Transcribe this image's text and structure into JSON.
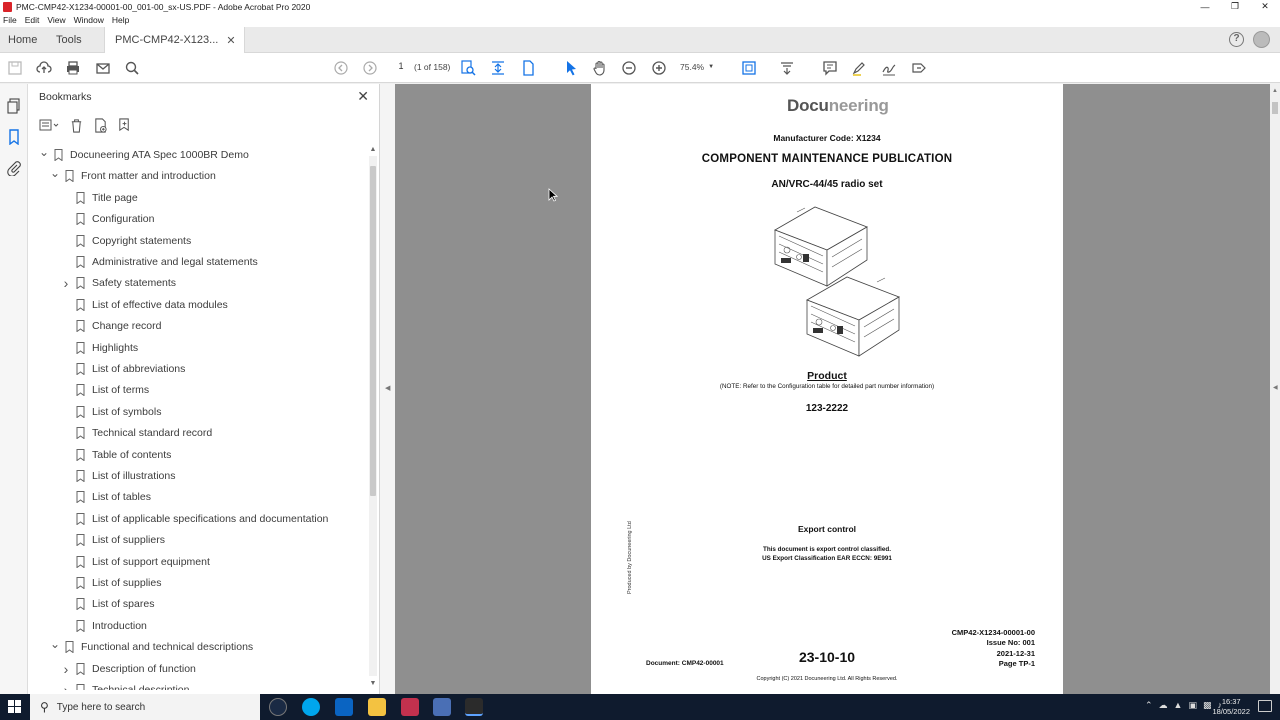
{
  "window": {
    "title": "PMC-CMP42-X1234-00001-00_001-00_sx-US.PDF - Adobe Acrobat Pro 2020"
  },
  "menu": [
    "File",
    "Edit",
    "View",
    "Window",
    "Help"
  ],
  "tabs": {
    "home": "Home",
    "tools": "Tools",
    "document": "PMC-CMP42-X123..."
  },
  "toolbar": {
    "page_number": "1",
    "page_count": "(1 of 158)",
    "zoom": "75.4%"
  },
  "bookmarks": {
    "header": "Bookmarks",
    "items": [
      {
        "label": "Docuneering ATA Spec 1000BR Demo",
        "level": 0,
        "toggle": "expanded"
      },
      {
        "label": "Front matter and introduction",
        "level": 1,
        "toggle": "expanded"
      },
      {
        "label": "Title page",
        "level": 2,
        "toggle": "none"
      },
      {
        "label": "Configuration",
        "level": 2,
        "toggle": "none"
      },
      {
        "label": "Copyright statements",
        "level": 2,
        "toggle": "none"
      },
      {
        "label": "Administrative and legal statements",
        "level": 2,
        "toggle": "none"
      },
      {
        "label": "Safety statements",
        "level": 2,
        "toggle": "collapsed"
      },
      {
        "label": "List of effective data modules",
        "level": 2,
        "toggle": "none"
      },
      {
        "label": "Change record",
        "level": 2,
        "toggle": "none"
      },
      {
        "label": "Highlights",
        "level": 2,
        "toggle": "none"
      },
      {
        "label": "List of abbreviations",
        "level": 2,
        "toggle": "none"
      },
      {
        "label": "List of terms",
        "level": 2,
        "toggle": "none"
      },
      {
        "label": "List of symbols",
        "level": 2,
        "toggle": "none"
      },
      {
        "label": "Technical standard record",
        "level": 2,
        "toggle": "none"
      },
      {
        "label": "Table of contents",
        "level": 2,
        "toggle": "none"
      },
      {
        "label": "List of illustrations",
        "level": 2,
        "toggle": "none"
      },
      {
        "label": "List of tables",
        "level": 2,
        "toggle": "none"
      },
      {
        "label": "List of applicable specifications and documentation",
        "level": 2,
        "toggle": "none"
      },
      {
        "label": "List of suppliers",
        "level": 2,
        "toggle": "none"
      },
      {
        "label": "List of support equipment",
        "level": 2,
        "toggle": "none"
      },
      {
        "label": "List of supplies",
        "level": 2,
        "toggle": "none"
      },
      {
        "label": "List of spares",
        "level": 2,
        "toggle": "none"
      },
      {
        "label": "Introduction",
        "level": 2,
        "toggle": "none"
      },
      {
        "label": "Functional and technical descriptions",
        "level": 1,
        "toggle": "expanded"
      },
      {
        "label": "Description of function",
        "level": 2,
        "toggle": "collapsed"
      },
      {
        "label": "Technical description",
        "level": 2,
        "toggle": "collapsed"
      }
    ]
  },
  "document": {
    "logo_main": "Docu",
    "logo_accent": "neering",
    "manufacturer": "Manufacturer Code: X1234",
    "title": "COMPONENT MAINTENANCE PUBLICATION",
    "subtitle": "AN/VRC-44/45 radio set",
    "product_heading": "Product",
    "product_note": "(NOTE: Refer to the Configuration table for detailed part number information)",
    "part_number": "123-2222",
    "export_heading": "Export control",
    "export_line1": "This document is export control classified.",
    "export_line2": "US Export Classification EAR ECCN: 9E991",
    "produced_by": "Produced by Docuneering Ltd",
    "doc_code": "CMP42-X1234-00001-00",
    "issue": "Issue No: 001",
    "date": "2021-12-31",
    "page": "Page TP-1",
    "document_label": "Document: CMP42-00001",
    "chapter": "23-10-10",
    "copyright": "Copyright (C) 2021 Docuneering Ltd. All Rights Reserved."
  },
  "taskbar": {
    "search_placeholder": "Type here to search",
    "time": "16:37",
    "date": "18/05/2022"
  },
  "colors": {
    "accent_blue": "#1473e6",
    "acrobat_red": "#d9242a",
    "taskbar": "#0f1b2e"
  }
}
